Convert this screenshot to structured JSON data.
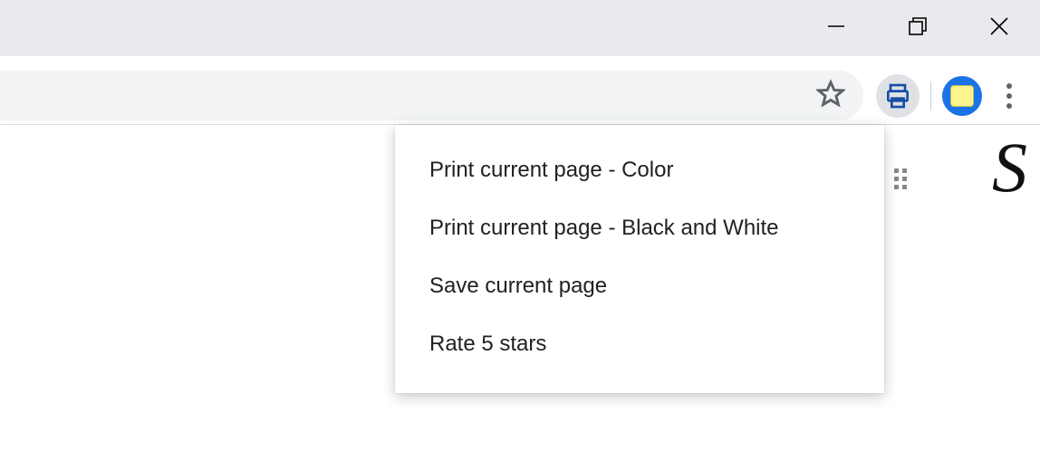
{
  "menu": {
    "items": [
      "Print current page - Color",
      "Print current page - Black and White",
      "Save current page",
      "Rate 5 stars"
    ]
  },
  "page": {
    "glyph": "S"
  }
}
